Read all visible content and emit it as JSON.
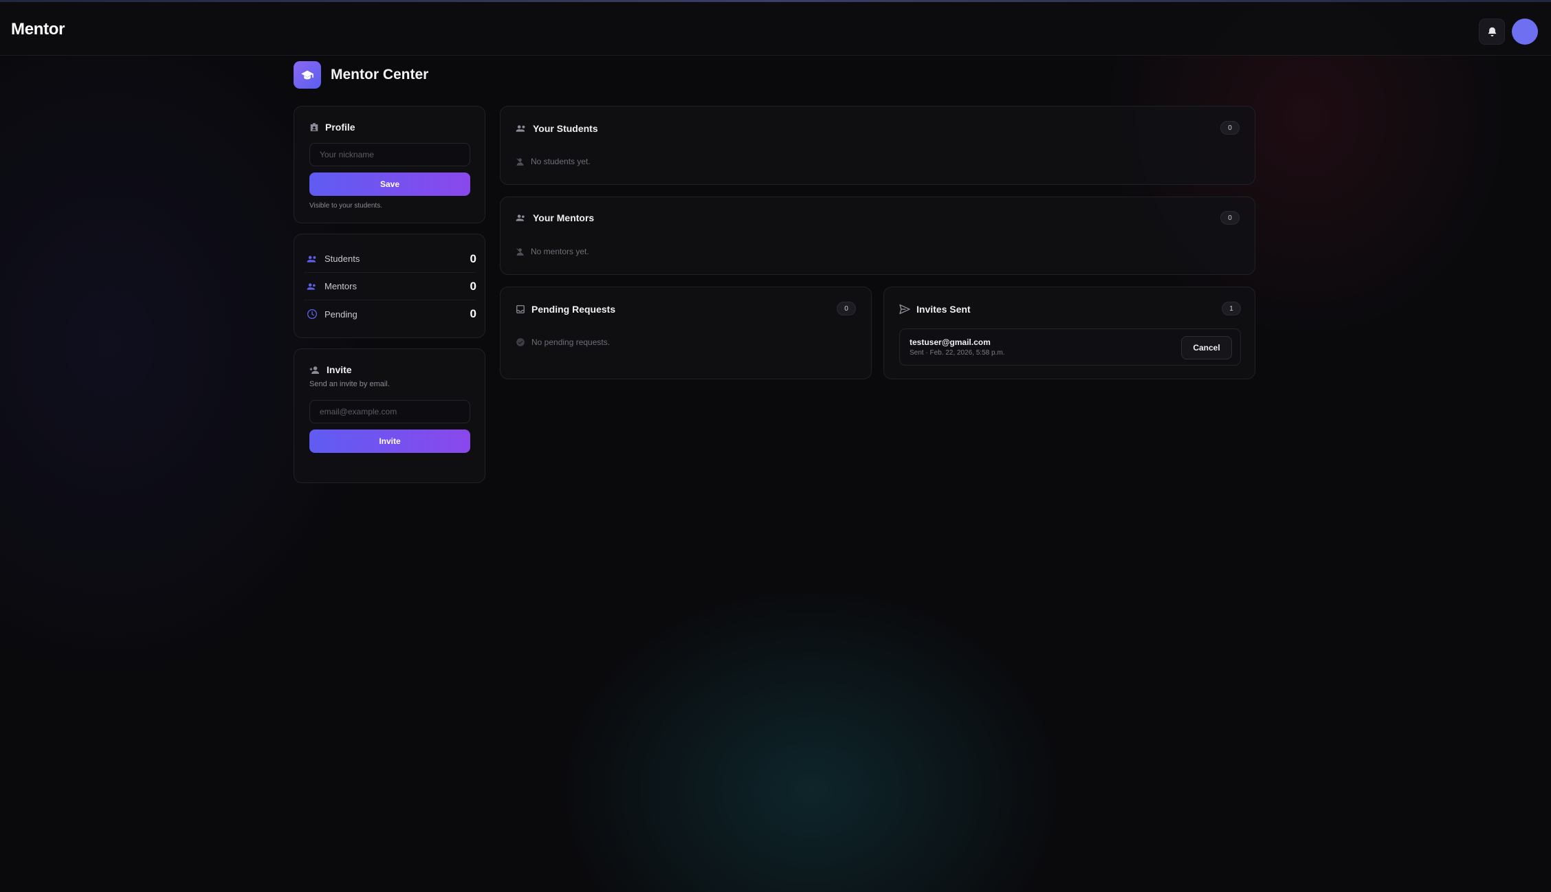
{
  "app": {
    "brand": "Mentor"
  },
  "page": {
    "title": "Mentor Center"
  },
  "profile": {
    "title": "Profile",
    "nickname_placeholder": "Your nickname",
    "save_label": "Save",
    "hint": "Visible to your students."
  },
  "stats": {
    "items": [
      {
        "label": "Students",
        "value": "0",
        "icon": "students-icon"
      },
      {
        "label": "Mentors",
        "value": "0",
        "icon": "mentors-icon"
      },
      {
        "label": "Pending",
        "value": "0",
        "icon": "clock-icon"
      }
    ]
  },
  "invite": {
    "title": "Invite",
    "subtitle": "Send an invite by email.",
    "email_placeholder": "email@example.com",
    "button_label": "Invite"
  },
  "students": {
    "title": "Your Students",
    "count": "0",
    "empty": "No students yet."
  },
  "mentors": {
    "title": "Your Mentors",
    "count": "0",
    "empty": "No mentors yet."
  },
  "pending": {
    "title": "Pending Requests",
    "count": "0",
    "empty": "No pending requests."
  },
  "invites_sent": {
    "title": "Invites Sent",
    "count": "1",
    "items": [
      {
        "email": "testuser@gmail.com",
        "meta": "Sent · Feb. 22, 2026, 5:58 p.m.",
        "cancel_label": "Cancel"
      }
    ]
  },
  "colors": {
    "accent": "#6f6ff2",
    "accent_gradient_end": "#8a48ec",
    "background": "#0a0a0d"
  }
}
